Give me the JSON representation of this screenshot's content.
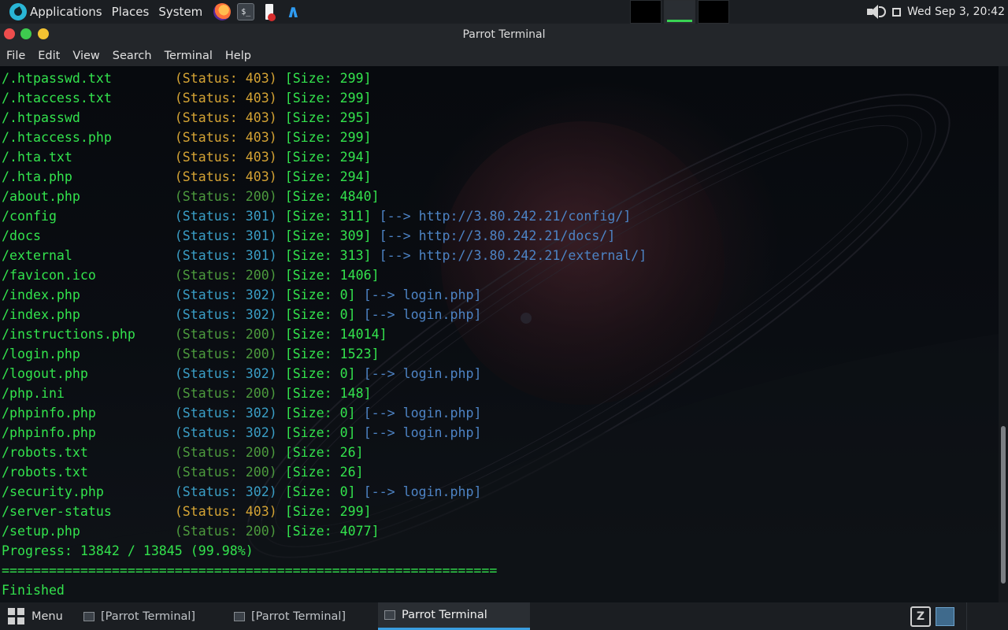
{
  "top_panel": {
    "menus": [
      "Applications",
      "Places",
      "System"
    ],
    "launchers": [
      "firefox-icon",
      "terminal-icon",
      "text-editor-icon",
      "vscode-icon"
    ],
    "workspaces": 3,
    "active_workspace": 2,
    "clock": "Wed Sep  3, 20:42"
  },
  "window": {
    "title": "Parrot Terminal",
    "menu": [
      "File",
      "Edit",
      "View",
      "Search",
      "Terminal",
      "Help"
    ]
  },
  "terminal": {
    "results": [
      {
        "path": "/.htpasswd.txt",
        "status": "403",
        "size": "299",
        "redirect": ""
      },
      {
        "path": "/.htaccess.txt",
        "status": "403",
        "size": "299",
        "redirect": ""
      },
      {
        "path": "/.htpasswd",
        "status": "403",
        "size": "295",
        "redirect": ""
      },
      {
        "path": "/.htaccess.php",
        "status": "403",
        "size": "299",
        "redirect": ""
      },
      {
        "path": "/.hta.txt",
        "status": "403",
        "size": "294",
        "redirect": ""
      },
      {
        "path": "/.hta.php",
        "status": "403",
        "size": "294",
        "redirect": ""
      },
      {
        "path": "/about.php",
        "status": "200",
        "size": "4840",
        "redirect": ""
      },
      {
        "path": "/config",
        "status": "301",
        "size": "311",
        "redirect": "http://3.80.242.21/config/"
      },
      {
        "path": "/docs",
        "status": "301",
        "size": "309",
        "redirect": "http://3.80.242.21/docs/"
      },
      {
        "path": "/external",
        "status": "301",
        "size": "313",
        "redirect": "http://3.80.242.21/external/"
      },
      {
        "path": "/favicon.ico",
        "status": "200",
        "size": "1406",
        "redirect": ""
      },
      {
        "path": "/index.php",
        "status": "302",
        "size": "0",
        "redirect": "login.php"
      },
      {
        "path": "/index.php",
        "status": "302",
        "size": "0",
        "redirect": "login.php"
      },
      {
        "path": "/instructions.php",
        "status": "200",
        "size": "14014",
        "redirect": ""
      },
      {
        "path": "/login.php",
        "status": "200",
        "size": "1523",
        "redirect": ""
      },
      {
        "path": "/logout.php",
        "status": "302",
        "size": "0",
        "redirect": "login.php"
      },
      {
        "path": "/php.ini",
        "status": "200",
        "size": "148",
        "redirect": ""
      },
      {
        "path": "/phpinfo.php",
        "status": "302",
        "size": "0",
        "redirect": "login.php"
      },
      {
        "path": "/phpinfo.php",
        "status": "302",
        "size": "0",
        "redirect": "login.php"
      },
      {
        "path": "/robots.txt",
        "status": "200",
        "size": "26",
        "redirect": ""
      },
      {
        "path": "/robots.txt",
        "status": "200",
        "size": "26",
        "redirect": ""
      },
      {
        "path": "/security.php",
        "status": "302",
        "size": "0",
        "redirect": "login.php"
      },
      {
        "path": "/server-status",
        "status": "403",
        "size": "299",
        "redirect": ""
      },
      {
        "path": "/setup.php",
        "status": "200",
        "size": "4077",
        "redirect": ""
      }
    ],
    "progress": "Progress: 13842 / 13845 (99.98%)",
    "separator": "===============================================================",
    "finished": "Finished"
  },
  "taskbar": {
    "menu_label": "Menu",
    "tasks": [
      "[Parrot Terminal]",
      "[Parrot Terminal]",
      "Parrot Terminal"
    ],
    "active_task": 2
  },
  "colors": {
    "path": "#33e34d",
    "status_403": "#d4a334",
    "status_200": "#4c9a3d",
    "status_30x": "#3a9ec6",
    "redirect": "#4d83c4",
    "accent": "#3a9ee0"
  }
}
